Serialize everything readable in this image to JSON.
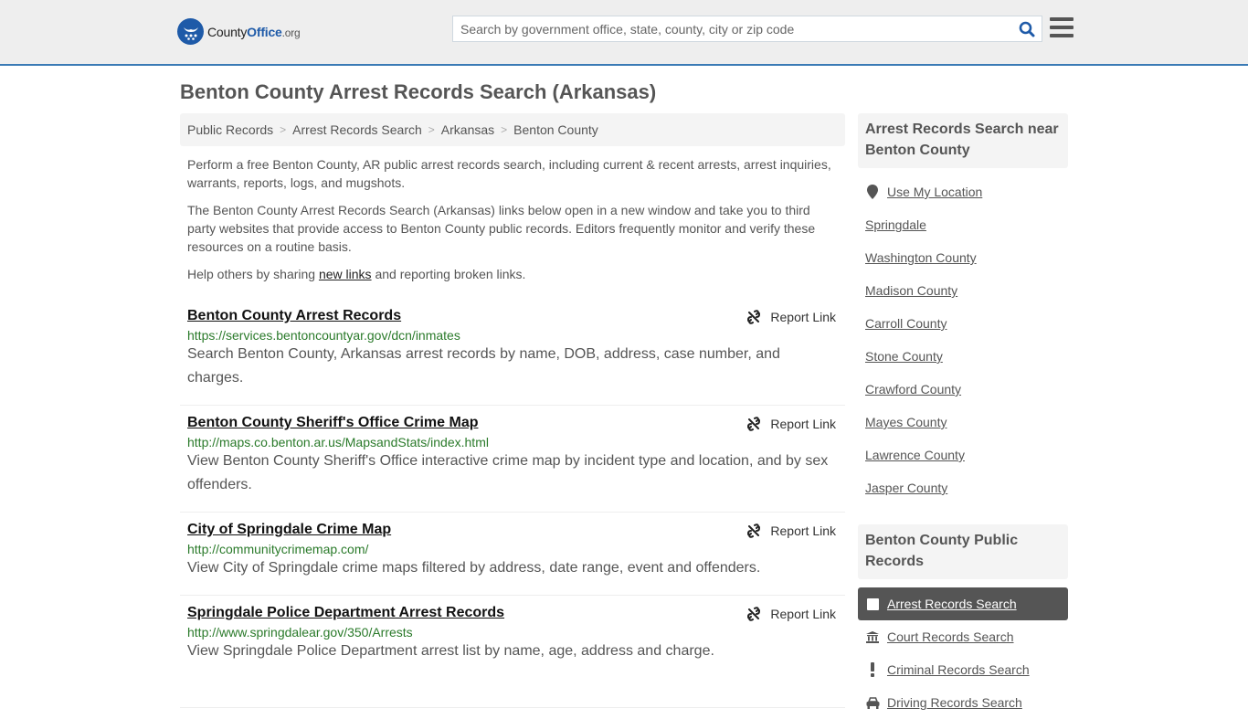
{
  "header": {
    "logo": {
      "county": "County",
      "office": "Office",
      "org": ".org"
    },
    "search": {
      "placeholder": "Search by government office, state, county, city or zip code",
      "value": ""
    },
    "colors": {
      "brand": "#1e5aa8",
      "header_border": "#3a7ab5"
    }
  },
  "page": {
    "title": "Benton County Arrest Records Search (Arkansas)"
  },
  "breadcrumb": [
    "Public Records",
    "Arrest Records Search",
    "Arkansas",
    "Benton County"
  ],
  "intro": {
    "p1": "Perform a free Benton County, AR public arrest records search, including current & recent arrests, arrest inquiries, warrants, reports, logs, and mugshots.",
    "p2": "The Benton County Arrest Records Search (Arkansas) links below open in a new window and take you to third party websites that provide access to Benton County public records. Editors frequently monitor and verify these resources on a routine basis.",
    "p3_before": "Help others by sharing ",
    "p3_link": "new links",
    "p3_after": " and reporting broken links."
  },
  "listings": [
    {
      "title": "Benton County Arrest Records",
      "url": "https://services.bentoncountyar.gov/dcn/inmates",
      "description": "Search Benton County, Arkansas arrest records by name, DOB, address, case number, and charges.",
      "report_label": "Report Link"
    },
    {
      "title": "Benton County Sheriff's Office Crime Map",
      "url": "http://maps.co.benton.ar.us/MapsandStats/index.html",
      "description": "View Benton County Sheriff's Office interactive crime map by incident type and location, and by sex offenders.",
      "report_label": "Report Link"
    },
    {
      "title": "City of Springdale Crime Map",
      "url": "http://communitycrimemap.com/",
      "description": "View City of Springdale crime maps filtered by address, date range, event and offenders.",
      "report_label": "Report Link"
    },
    {
      "title": "Springdale Police Department Arrest Records",
      "url": "http://www.springdalear.gov/350/Arrests",
      "description": "View Springdale Police Department arrest list by name, age, address and charge.",
      "report_label": "Report Link"
    }
  ],
  "sidebar": {
    "nearby": {
      "heading": "Arrest Records Search near Benton County",
      "use_location": "Use My Location",
      "items": [
        "Springdale",
        "Washington County",
        "Madison County",
        "Carroll County",
        "Stone County",
        "Crawford County",
        "Mayes County",
        "Lawrence County",
        "Jasper County"
      ]
    },
    "public_records": {
      "heading": "Benton County Public Records",
      "items": [
        {
          "label": "Arrest Records Search",
          "icon": "square-icon",
          "active": true
        },
        {
          "label": "Court Records Search",
          "icon": "courthouse-icon",
          "active": false
        },
        {
          "label": "Criminal Records Search",
          "icon": "exclamation-icon",
          "active": false
        },
        {
          "label": "Driving Records Search",
          "icon": "car-icon",
          "active": false
        }
      ]
    }
  }
}
